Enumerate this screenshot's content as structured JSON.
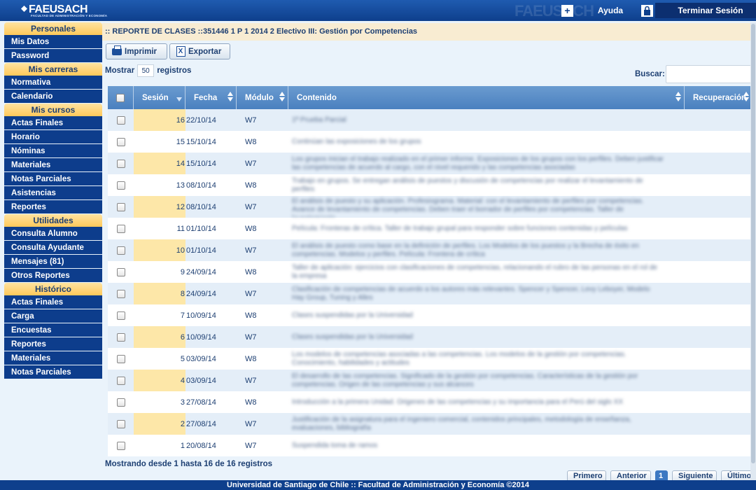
{
  "header": {
    "logo_text": "FAEUSACH",
    "logo_subtext": "FACULTAD DE ADMINISTRACIÓN Y ECONOMÍA",
    "ayuda_label": "Ayuda",
    "logout_label": "Terminar Sesión"
  },
  "sidebar": {
    "sections": [
      {
        "title": "Personales",
        "items": [
          "Mis Datos",
          "Password"
        ]
      },
      {
        "title": "Mis carreras",
        "items": [
          "Normativa",
          "Calendario"
        ]
      },
      {
        "title": "Mis cursos",
        "items": [
          "Actas Finales",
          "Horario",
          "Nóminas",
          "Materiales",
          "Notas Parciales",
          "Asistencias",
          "Reportes"
        ]
      },
      {
        "title": "Utilidades",
        "items": [
          "Consulta Alumno",
          "Consulta Ayudante",
          "Mensajes (81)",
          "Otros Reportes"
        ]
      },
      {
        "title": "Histórico",
        "items": [
          "Actas Finales",
          "Carga",
          "Encuestas",
          "Reportes",
          "Materiales",
          "Notas Parciales"
        ]
      }
    ]
  },
  "breadcrumb": ":: REPORTE DE CLASES ::351446 1 P 1 2014 2 Electivo III: Gestión por Competencias",
  "toolbar": {
    "print_label": "Imprimir",
    "export_label": "Exportar"
  },
  "length_menu": {
    "prefix": "Mostrar",
    "value": "50",
    "suffix": "registros"
  },
  "search": {
    "label": "Buscar:",
    "value": ""
  },
  "table": {
    "headers": [
      "",
      "Sesión",
      "Fecha",
      "Módulo",
      "Contenido",
      "Recuperación"
    ],
    "rows": [
      {
        "sesion": "16",
        "fecha": "22/10/14",
        "modulo": "W7",
        "contenido": "1ª Prueba Parcial"
      },
      {
        "sesion": "15",
        "fecha": "15/10/14",
        "modulo": "W8",
        "contenido": "Continúan las exposiciones de los grupos"
      },
      {
        "sesion": "14",
        "fecha": "15/10/14",
        "modulo": "W7",
        "contenido": "Los grupos inician el trabajo realizado en el primer informe. Exposiciones de los grupos con los perfiles. Deben justificar las competencias de acuerdo al cargo, con el nivel requerido y las competencias asociadas"
      },
      {
        "sesion": "13",
        "fecha": "08/10/14",
        "modulo": "W8",
        "contenido": "Trabajo en grupos. Se entregan análisis de puestos y discusión de competencias por realizar el levantamiento de perfiles"
      },
      {
        "sesion": "12",
        "fecha": "08/10/14",
        "modulo": "W7",
        "contenido": "El análisis de puesto y su aplicación. Profesiograma. Material: con el levantamiento de perfiles por competencias. Avance de levantamiento de competencias. Deben traer el borrador de perfiles por competencias. Taller de levantamiento"
      },
      {
        "sesion": "11",
        "fecha": "01/10/14",
        "modulo": "W8",
        "contenido": "Película: Fronteras de crítica. Taller de trabajo grupal para responder sobre funciones contenidas y películas"
      },
      {
        "sesion": "10",
        "fecha": "01/10/14",
        "modulo": "W7",
        "contenido": "El análisis de puesto como base en la definición de perfiles. Los Modelos de los puestos y la Brecha de éxito en competencias. Modelos y perfiles. Película: Frontera de crítica"
      },
      {
        "sesion": "9",
        "fecha": "24/09/14",
        "modulo": "W8",
        "contenido": "Taller de aplicación: ejercicios con clasificaciones de competencias, relacionando el rubro de las personas en el rol de la empresa"
      },
      {
        "sesion": "8",
        "fecha": "24/09/14",
        "modulo": "W7",
        "contenido": "Clasificación de competencias de acuerdo a los autores más relevantes. Spencer y Spencer, Levy Leboyer, Modelo Hay Group, Tuning y Alles"
      },
      {
        "sesion": "7",
        "fecha": "10/09/14",
        "modulo": "W8",
        "contenido": "Clases suspendidas por la Universidad"
      },
      {
        "sesion": "6",
        "fecha": "10/09/14",
        "modulo": "W7",
        "contenido": "Clases suspendidas por la Universidad"
      },
      {
        "sesion": "5",
        "fecha": "03/09/14",
        "modulo": "W8",
        "contenido": "Los modelos de competencias asociadas a las competencias. Los modelos de la gestión por competencias. Conocimiento, habilidades y actitudes"
      },
      {
        "sesion": "4",
        "fecha": "03/09/14",
        "modulo": "W7",
        "contenido": "El desarrollo de las competencias. Significado de la gestión por competencias. Características de la gestión por competencias. Origen de las competencias y sus alcances"
      },
      {
        "sesion": "3",
        "fecha": "27/08/14",
        "modulo": "W8",
        "contenido": "Introducción a la primera Unidad. Origenes de las competencias y su importancia para el Perú del siglo XX"
      },
      {
        "sesion": "2",
        "fecha": "27/08/14",
        "modulo": "W7",
        "contenido": "Justificación de la asignatura para el ingeniero comercial, contenidos principales, metodología de enseñanza, evaluaciones, bibliografía"
      },
      {
        "sesion": "1",
        "fecha": "20/08/14",
        "modulo": "W7",
        "contenido": "Suspendida toma de ramos"
      }
    ]
  },
  "info_text": "Mostrando desde 1 hasta 16 de 16 registros",
  "pagination": {
    "first": "Primero",
    "prev": "Anterior",
    "current": "1",
    "next": "Siguiente",
    "last": "Último"
  },
  "footer": "Universidad de Santiago de Chile :: Facultad de Administración y Economía ©2014"
}
